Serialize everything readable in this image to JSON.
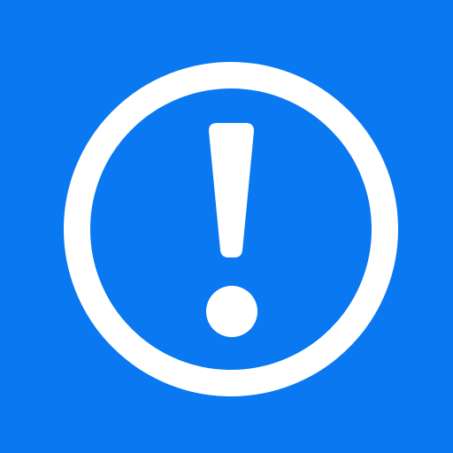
{
  "colors": {
    "background": "#0a78f0",
    "foreground": "#ffffff"
  },
  "icon": {
    "name": "exclamation-circle-icon"
  }
}
